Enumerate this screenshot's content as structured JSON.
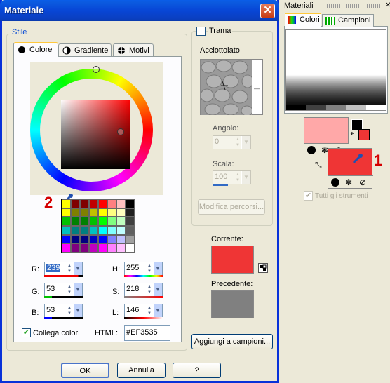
{
  "dialog": {
    "title": "Materiale",
    "close_symbol": "✕",
    "style_group_label": "Stile",
    "tabs": [
      {
        "label": "Colore",
        "icon": "circle-icon"
      },
      {
        "label": "Gradiente",
        "icon": "gradient-icon"
      },
      {
        "label": "Motivi",
        "icon": "pattern-icon"
      }
    ],
    "annotation_2": "2",
    "swatches": [
      "#ffff00",
      "#800000",
      "#800000",
      "#c00000",
      "#ff0000",
      "#ff8080",
      "#ffc0c0",
      "#000000",
      "#ffff00",
      "#808000",
      "#808000",
      "#c0c000",
      "#ffff00",
      "#ffff80",
      "#ffffc0",
      "#202020",
      "#00c000",
      "#008000",
      "#008000",
      "#00c000",
      "#00ff00",
      "#80ff80",
      "#c0ffc0",
      "#404040",
      "#00c0c0",
      "#008080",
      "#008080",
      "#00c0c0",
      "#00ffff",
      "#80ffff",
      "#c0ffff",
      "#606060",
      "#0000ff",
      "#000080",
      "#000080",
      "#0000c0",
      "#0000ff",
      "#8080ff",
      "#c0c0ff",
      "#a0a0a0",
      "#ff00ff",
      "#800080",
      "#800080",
      "#c000c0",
      "#ff00ff",
      "#ff80ff",
      "#ffc0ff",
      "#ffffff"
    ],
    "fields": {
      "r_label": "R:",
      "r_value": "239",
      "g_label": "G:",
      "g_value": "53",
      "b_label": "B:",
      "b_value": "53",
      "h_label": "H:",
      "h_value": "255",
      "s_label": "S:",
      "s_value": "218",
      "l_label": "L:",
      "l_value": "146",
      "html_label": "HTML:",
      "html_value": "#EF3535"
    },
    "link_colors_label": "Collega colori",
    "trama_label": "Trama",
    "texture_name": "Acciottolato",
    "angle_label": "Angolo:",
    "angle_value": "0",
    "scale_label": "Scala:",
    "scale_value": "100",
    "edit_paths_label": "Modifica percorsi...",
    "current_label": "Corrente:",
    "previous_label": "Precedente:",
    "add_to_swatches_label": "Aggiungi a campioni...",
    "ok_label": "OK",
    "cancel_label": "Annulla",
    "help_label": "?",
    "current_color": "#ef3535",
    "previous_color": "#808080"
  },
  "palette": {
    "title": "Materiali",
    "tab_colors": "Colori",
    "tab_swatches": "Campioni",
    "annotation_1": "1",
    "all_tools_label": "Tutti gli strumenti",
    "foreground_color": "#ffa8a8",
    "background_color": "#ef3535"
  }
}
